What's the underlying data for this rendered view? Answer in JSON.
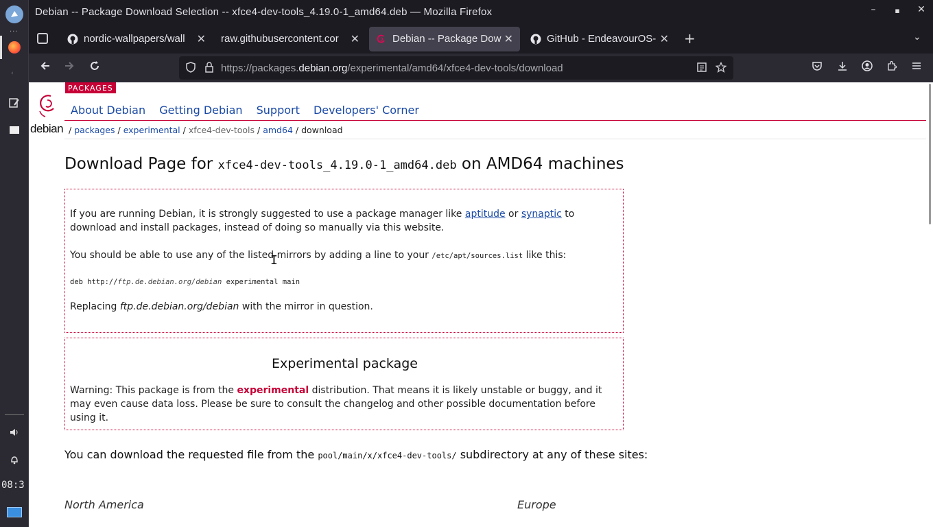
{
  "panel": {
    "clock": "08:3",
    "dots": "..."
  },
  "window": {
    "title": "Debian -- Package Download Selection -- xfce4-dev-tools_4.19.0-1_amd64.deb — Mozilla Firefox",
    "controls": {
      "minimize": "–",
      "maximize": "▪",
      "close": "✕"
    }
  },
  "tabs": [
    {
      "label": "nordic-wallpapers/wall",
      "icon": "github-icon",
      "active": false
    },
    {
      "label": "raw.githubusercontent.cor",
      "icon": "none",
      "active": false
    },
    {
      "label": "Debian -- Package Dow",
      "icon": "debian-icon",
      "active": true
    },
    {
      "label": "GitHub - EndeavourOS-",
      "icon": "github-icon",
      "active": false
    }
  ],
  "tabbar": {
    "new_tab": "+",
    "list_all": "⌄"
  },
  "nav": {
    "url_prefix": "https://packages.",
    "url_domain": "debian.org",
    "url_path": "/experimental/amd64/xfce4-dev-tools/download"
  },
  "header": {
    "badge": "PACKAGES",
    "logo_word": "debian",
    "links": [
      "About Debian",
      "Getting Debian",
      "Support",
      "Developers' Corner"
    ]
  },
  "breadcrumb": {
    "sep": "/",
    "packages": "packages",
    "experimental": "experimental",
    "pkg": "xfce4-dev-tools",
    "arch": "amd64",
    "current": "download"
  },
  "heading": {
    "prefix": "Download Page for ",
    "file": "xfce4-dev-tools_4.19.0-1_amd64.deb",
    "suffix": " on AMD64 machines"
  },
  "box1": {
    "p1_start": "If you are running Debian, it is strongly suggested to use a package manager like ",
    "aptitude": "aptitude",
    "or": " or ",
    "synaptic": "synaptic",
    "p1_end": " to download and install packages, instead of doing so manually via this website.",
    "p2_start": "You should be able to use any of the listed mirrors by adding a line to your ",
    "sources_file": "/etc/apt/sources.list",
    "p2_end": " like this:",
    "deb_prefix": "deb http://",
    "mirror": "ftp.de.debian.org/debian",
    "deb_suffix": " experimental main",
    "p3_start": "Replacing ",
    "p3_end": " with the mirror in question."
  },
  "box2": {
    "title": "Experimental package",
    "warn_start": "Warning: This package is from the ",
    "warn_word": "experimental",
    "warn_end": " distribution. That means it is likely unstable or buggy, and it may even cause data loss. Please be sure to consult the changelog and other possible documentation before using it."
  },
  "download": {
    "text_start": "You can download the requested file from the ",
    "dir": "pool/main/x/xfce4-dev-tools/",
    "text_end": " subdirectory at any of these sites:"
  },
  "regions": [
    "North America",
    "Europe"
  ],
  "colors": {
    "debian_red": "#c70036",
    "link_blue": "#1a4aa6",
    "firefox_dark": "#1c1b22"
  }
}
